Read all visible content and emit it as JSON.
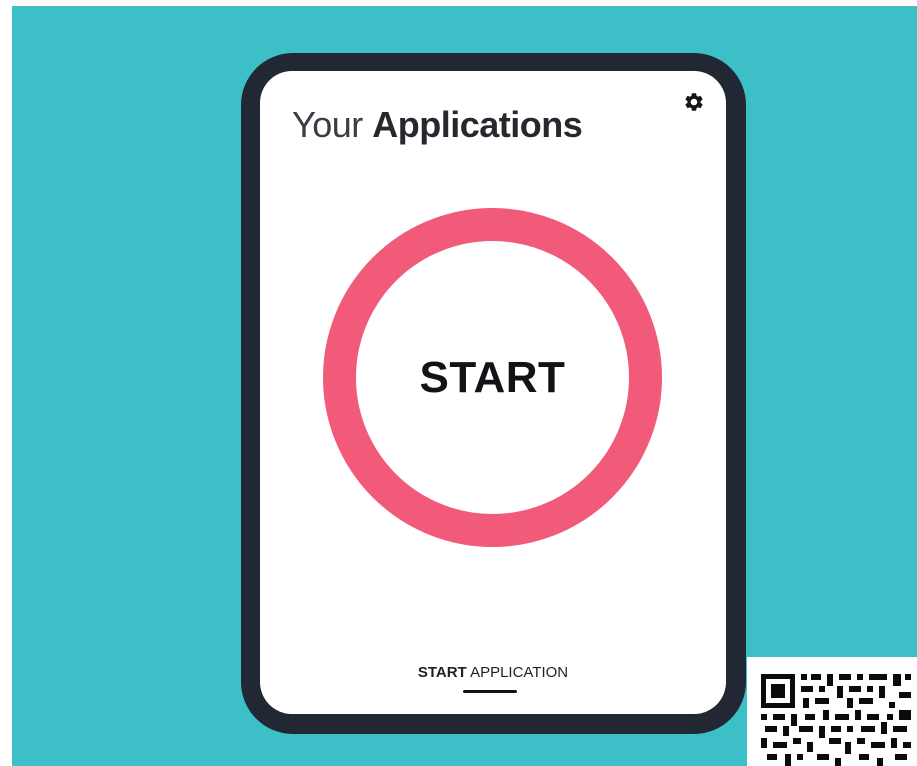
{
  "header": {
    "title_regular": "Your",
    "title_bold": "Applications"
  },
  "settings": {
    "icon": "gear-icon"
  },
  "main": {
    "start_button_label": "START"
  },
  "bottom_tab": {
    "label_bold": "START",
    "label_regular": "APPLICATION"
  },
  "colors": {
    "background": "#3cbfc7",
    "device_frame": "#212733",
    "ring": "#f25a7a"
  }
}
